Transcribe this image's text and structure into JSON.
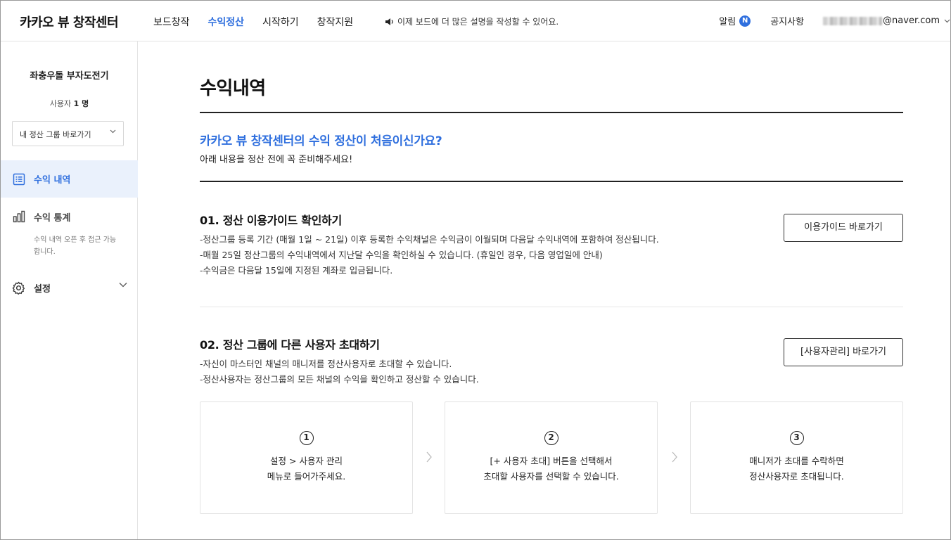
{
  "header": {
    "logo": "카카오 뷰 창작센터",
    "nav": [
      "보드창작",
      "수익정산",
      "시작하기",
      "창작지원"
    ],
    "notice": "이제 보드에 더 많은 설명을 작성할 수 있어요.",
    "alarm_label": "알림",
    "alarm_badge": "N",
    "notice_link": "공지사항",
    "email_suffix": "@naver.com"
  },
  "sidebar": {
    "group_name": "좌충우돌 부자도전기",
    "user_count_prefix": "사용자",
    "user_count": "1 명",
    "group_select": "내 정산 그룹 바로가기",
    "menu_revenue": "수익 내역",
    "menu_stats": "수익 통계",
    "stats_note": "수익 내역 오픈 후 접근 가능합니다.",
    "menu_settings": "설정"
  },
  "main": {
    "title": "수익내역",
    "first_title": "카카오 뷰 창작센터의 수익 정산이 처음이신가요?",
    "first_sub": "아래 내용을 정산 전에 꼭 준비해주세요!",
    "sec1": {
      "title": "01. 정산 이용가이드 확인하기",
      "lines": [
        "-정산그룹 등록 기간 (매월 1일 ~ 21일) 이후 등록한 수익채널은 수익금이 이월되며 다음달 수익내역에 포함하여 정산됩니다.",
        "-매월 25일 정산그룹의 수익내역에서 지난달 수익을 확인하실 수 있습니다. (휴일인 경우, 다음 영업일에 안내)",
        "-수익금은 다음달 15일에 지정된 계좌로 입금됩니다."
      ],
      "button": "이용가이드 바로가기"
    },
    "sec2": {
      "title": "02. 정산 그룹에 다른 사용자 초대하기",
      "lines": [
        "-자신이 마스터인 채널의 매니저를 정산사용자로 초대할 수 있습니다.",
        "-정산사용자는 정산그룹의 모든 채널의 수익을 확인하고 정산할 수 있습니다."
      ],
      "button": "[사용자관리] 바로가기"
    },
    "steps": [
      {
        "num": "1",
        "line1": "설정 > 사용자 관리",
        "line2": "메뉴로 들어가주세요."
      },
      {
        "num": "2",
        "line1": "[+ 사용자 초대] 버튼을 선택해서",
        "line2": "초대할 사용자를 선택할 수 있습니다."
      },
      {
        "num": "3",
        "line1": "매니저가 초대를 수락하면",
        "line2": "정산사용자로 초대됩니다."
      }
    ]
  },
  "colors": {
    "accent": "#2f6fde",
    "active_bg": "#eaf1fc"
  }
}
